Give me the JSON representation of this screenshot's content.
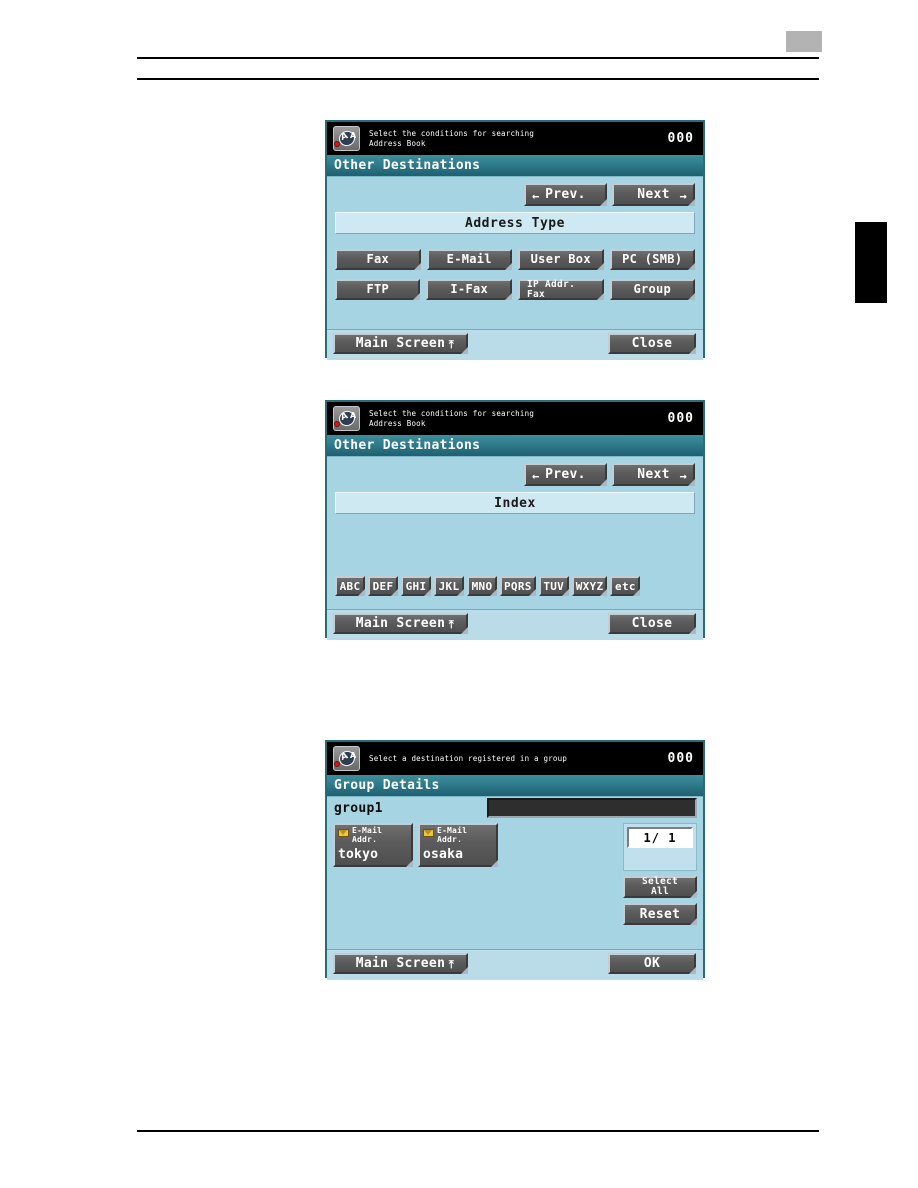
{
  "page": {
    "page_number_placeholder": "",
    "chapter_tab": ""
  },
  "panels": [
    {
      "status": {
        "message": "Select the conditions for searching\nAddress Book",
        "counter": "000",
        "icon": "address-book-search-icon"
      },
      "title": "Other Destinations",
      "nav": {
        "prev": "Prev.",
        "next": "Next",
        "prev_arrow": "←",
        "next_arrow": "→"
      },
      "band": "Address Type",
      "buttons_row1": [
        "Fax",
        "E-Mail",
        "User Box",
        "PC (SMB)"
      ],
      "buttons_row2": [
        "FTP",
        "I-Fax",
        "IP Addr.\nFax",
        "Group"
      ],
      "footer": {
        "main_screen": "Main Screen",
        "main_screen_glyph": "⤒",
        "right_button": "Close"
      }
    },
    {
      "status": {
        "message": "Select the conditions for searching\nAddress Book",
        "counter": "000",
        "icon": "address-book-search-icon"
      },
      "title": "Other Destinations",
      "nav": {
        "prev": "Prev.",
        "next": "Next",
        "prev_arrow": "←",
        "next_arrow": "→"
      },
      "band": "Index",
      "index_buttons": [
        "ABC",
        "DEF",
        "GHI",
        "JKL",
        "MNO",
        "PQRS",
        "TUV",
        "WXYZ",
        "etc"
      ],
      "footer": {
        "main_screen": "Main Screen",
        "main_screen_glyph": "⤒",
        "right_button": "Close"
      }
    },
    {
      "status": {
        "message": "Select a destination registered in a group",
        "counter": "000",
        "icon": "address-book-group-icon"
      },
      "title": "Group Details",
      "group_name": "group1",
      "group_field_value": "",
      "destinations": [
        {
          "type": "E-Mail\nAddr.",
          "name": "tokyo",
          "icon": "envelope-icon"
        },
        {
          "type": "E-Mail\nAddr.",
          "name": "osaka",
          "icon": "envelope-icon"
        }
      ],
      "page_indicator": "1/ 1",
      "select_all": "Select\nAll",
      "reset": "Reset",
      "footer": {
        "main_screen": "Main Screen",
        "main_screen_glyph": "⤒",
        "right_button": "OK"
      }
    }
  ],
  "colors": {
    "lcd_background": "#a6d4e3",
    "title_bar": "#2e7b8c",
    "status_bar": "#000000",
    "button_face": "#5c5c5c",
    "band": "#cfe9f2",
    "envelope": "#f2c63c"
  }
}
